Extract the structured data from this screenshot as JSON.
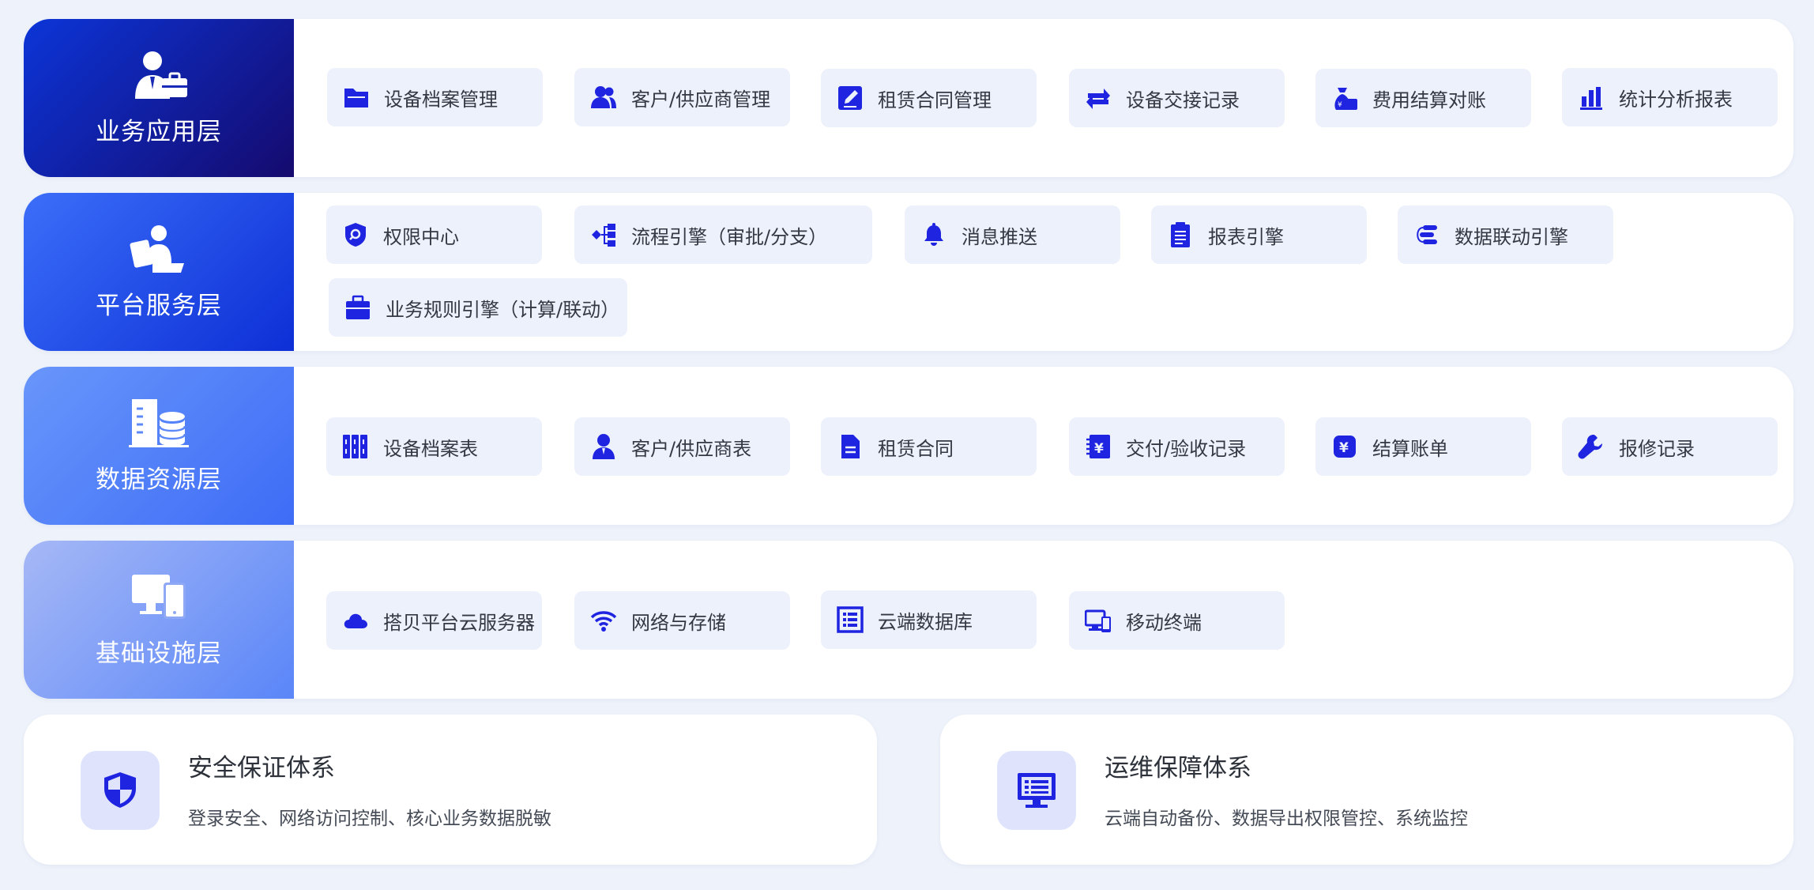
{
  "layers": [
    {
      "title": "业务应用层",
      "icon": "business-person-icon",
      "gradient": [
        "#0c35d8",
        "#150a6e"
      ],
      "items": [
        {
          "label": "设备档案管理",
          "icon": "folder-icon"
        },
        {
          "label": "客户/供应商管理",
          "icon": "users-icon"
        },
        {
          "label": "租赁合同管理",
          "icon": "edit-document-icon"
        },
        {
          "label": "设备交接记录",
          "icon": "exchange-arrows-icon"
        },
        {
          "label": "费用结算对账",
          "icon": "money-bag-icon"
        },
        {
          "label": "统计分析报表",
          "icon": "bar-chart-icon"
        }
      ]
    },
    {
      "title": "平台服务层",
      "icon": "person-at-laptop-icon",
      "gradient": [
        "#3b6ef9",
        "#0d2fd6"
      ],
      "items": [
        {
          "label": "权限中心",
          "icon": "shield-search-icon"
        },
        {
          "label": "流程引擎（审批/分支）",
          "icon": "workflow-icon"
        },
        {
          "label": "消息推送",
          "icon": "bell-icon"
        },
        {
          "label": "报表引擎",
          "icon": "clipboard-icon"
        },
        {
          "label": "数据联动引擎",
          "icon": "data-link-icon"
        },
        {
          "label": "业务规则引擎（计算/联动）",
          "icon": "briefcase-icon"
        }
      ]
    },
    {
      "title": "数据资源层",
      "icon": "building-database-icon",
      "gradient": [
        "#6896fb",
        "#3e6cf6"
      ],
      "items": [
        {
          "label": "设备档案表",
          "icon": "archive-binders-icon"
        },
        {
          "label": "客户/供应商表",
          "icon": "user-icon"
        },
        {
          "label": "租赁合同",
          "icon": "document-icon"
        },
        {
          "label": "交付/验收记录",
          "icon": "yen-notebook-icon"
        },
        {
          "label": "结算账单",
          "icon": "yen-badge-icon"
        },
        {
          "label": "报修记录",
          "icon": "wrench-icon"
        }
      ]
    },
    {
      "title": "基础设施层",
      "icon": "devices-icon",
      "gradient": [
        "#a6b8f6",
        "#5a86f8"
      ],
      "items": [
        {
          "label": "搭贝平台云服务器",
          "icon": "cloud-icon"
        },
        {
          "label": "网络与存储",
          "icon": "wifi-icon"
        },
        {
          "label": "云端数据库",
          "icon": "list-box-icon"
        },
        {
          "label": "移动终端",
          "icon": "desktop-mobile-icon"
        }
      ]
    }
  ],
  "cards": [
    {
      "title": "安全保证体系",
      "desc": "登录安全、网络访问控制、核心业务数据脱敏",
      "icon": "security-shield-icon"
    },
    {
      "title": "运维保障体系",
      "desc": "云端自动备份、数据导出权限管控、系统监控",
      "icon": "monitor-icon"
    }
  ]
}
